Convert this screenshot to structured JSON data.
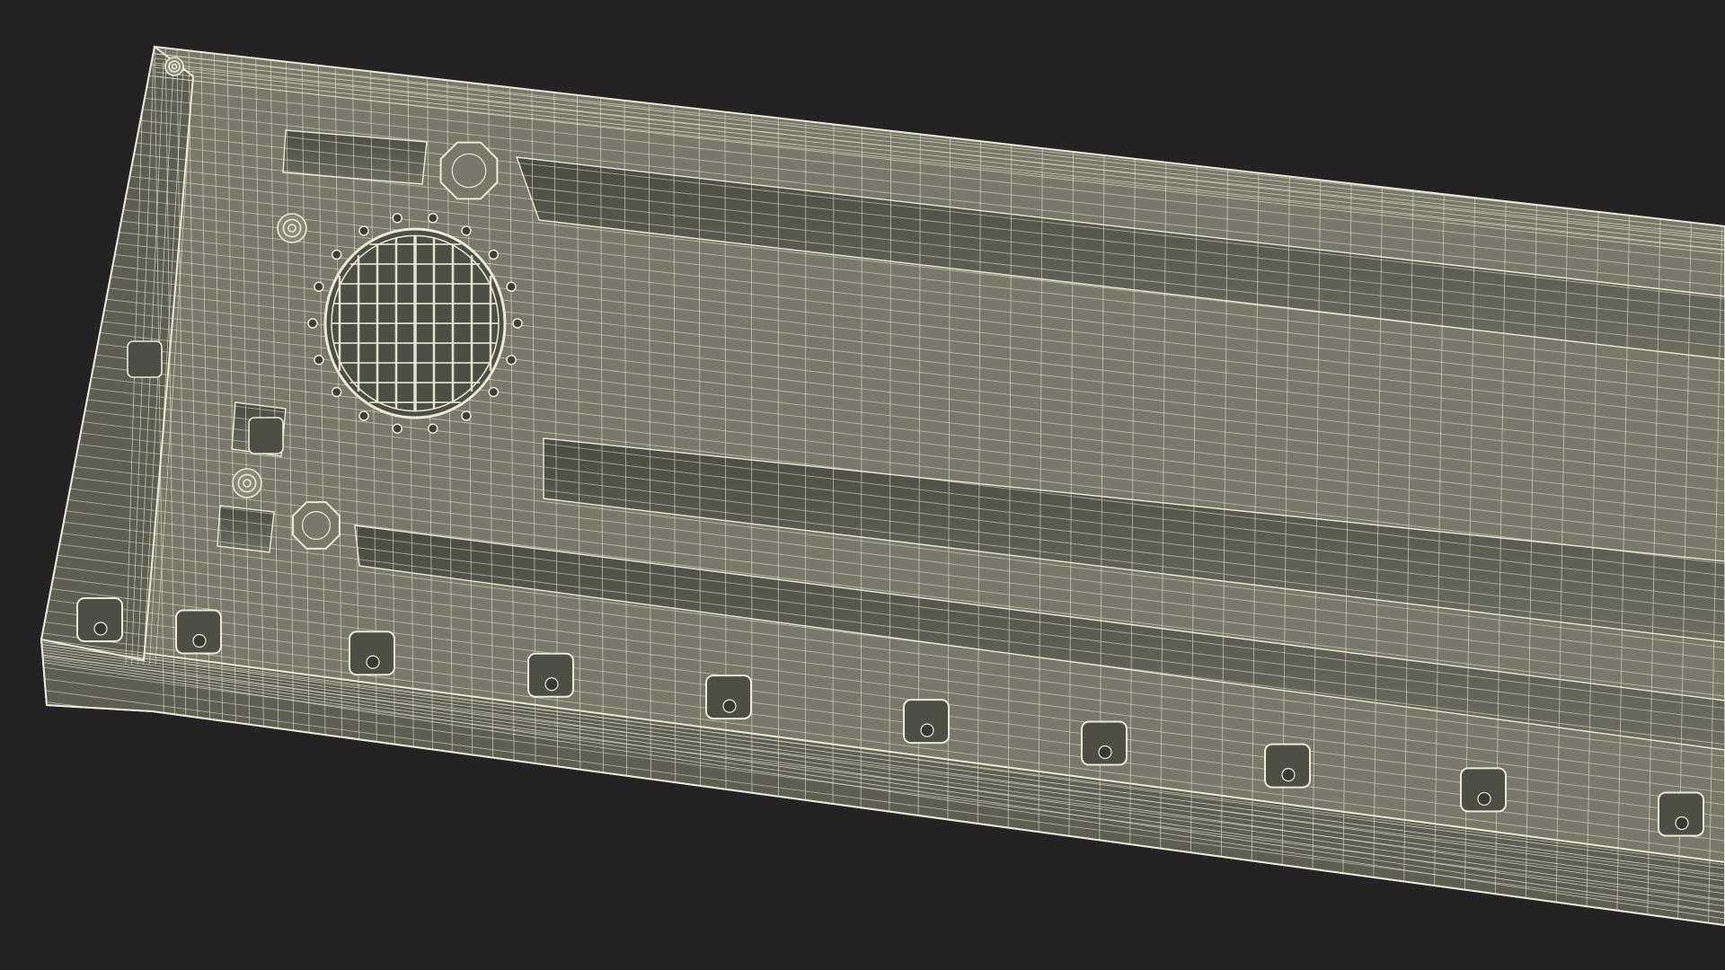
{
  "scene": {
    "background_color": "#232323",
    "model_fill_color": "#79786a",
    "model_shadow_color": "#5f5e52",
    "model_dark_recess_color": "#4f4e45",
    "wireframe_color": "#ecead6",
    "subject": "wireframe-3d-model-render"
  }
}
